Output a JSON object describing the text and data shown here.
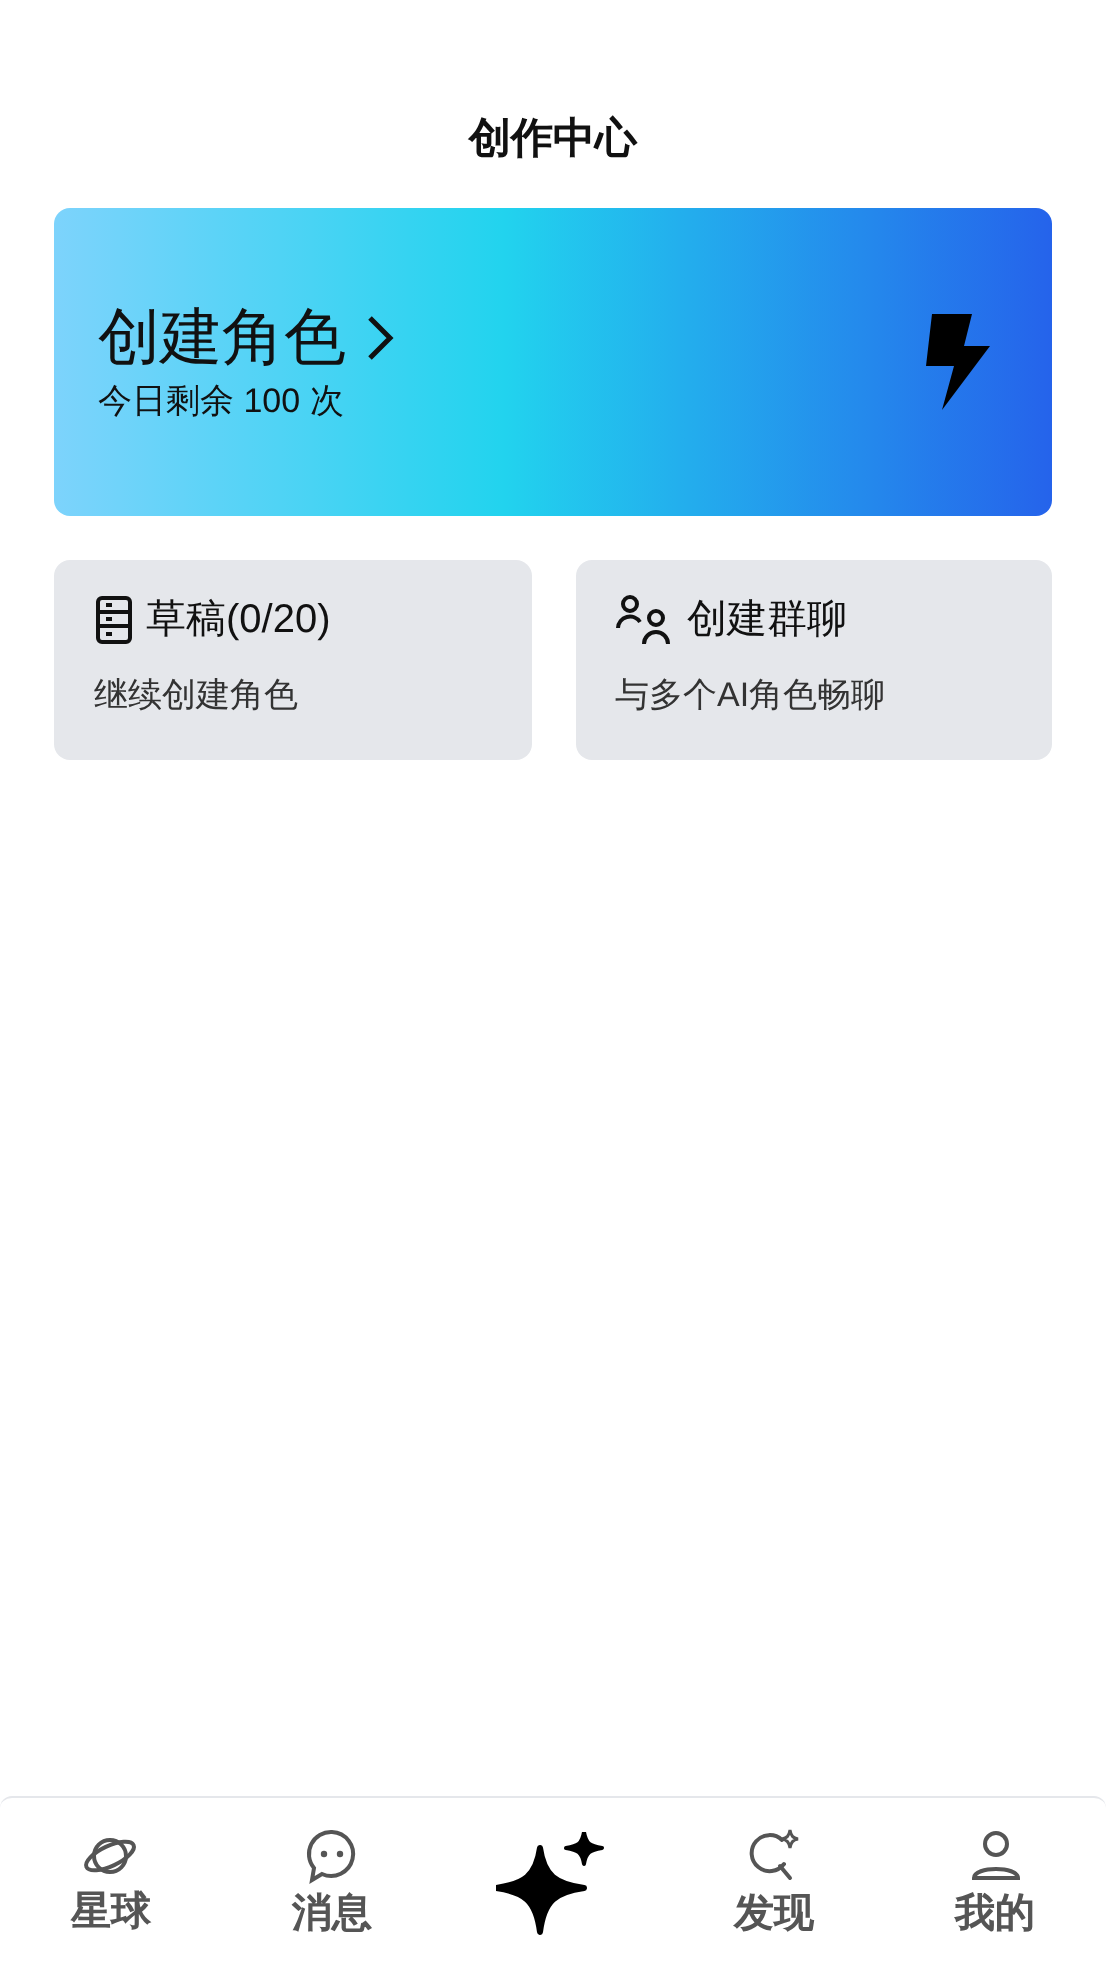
{
  "header": {
    "title": "创作中心"
  },
  "banner": {
    "title": "创建角色",
    "subtitle": "今日剩余 100 次"
  },
  "cards": [
    {
      "kind": "drafts",
      "title": "草稿(0/20)",
      "subtitle": "继续创建角色"
    },
    {
      "kind": "group",
      "title": "创建群聊",
      "subtitle": "与多个AI角色畅聊"
    }
  ],
  "tab_bar": [
    {
      "kind": "planet",
      "label": "星球",
      "selected": false
    },
    {
      "kind": "chat",
      "label": "消息",
      "selected": false
    },
    {
      "kind": "create",
      "selected": true
    },
    {
      "kind": "discover",
      "label": "发现",
      "selected": false
    },
    {
      "kind": "profile",
      "label": "我的",
      "selected": false
    }
  ]
}
